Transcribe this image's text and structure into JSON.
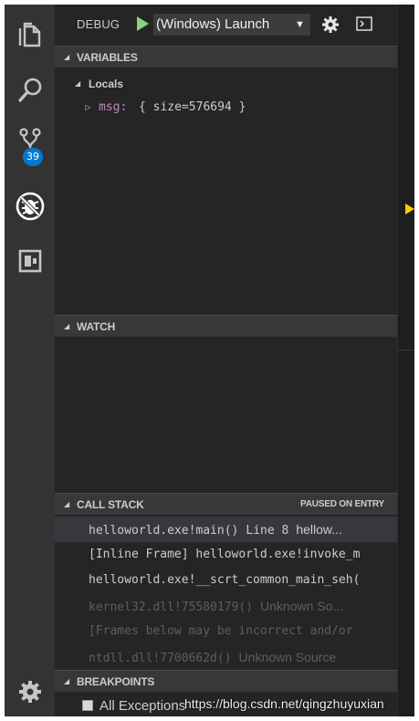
{
  "activity_bar": {
    "scm_badge": "39",
    "icons": [
      "files-icon",
      "search-icon",
      "source-control-icon",
      "debug-icon",
      "extensions-icon",
      "settings-gear-icon"
    ]
  },
  "toolbar": {
    "debug_label": "DEBUG",
    "launch_config": "(Windows) Launch",
    "dropdown_arrow": "▼"
  },
  "variables": {
    "header": "VARIABLES",
    "locals_label": "Locals",
    "items": [
      {
        "name": "msg:",
        "value": "{ size=576694 }"
      }
    ]
  },
  "watch": {
    "header": "WATCH"
  },
  "call_stack": {
    "header": "CALL STACK",
    "status": "PAUSED ON ENTRY",
    "frames": [
      {
        "name": "helloworld.exe!main()",
        "line": "Line 8",
        "source": "hellow..."
      },
      {
        "name": "[Inline Frame] helloworld.exe!invoke_m",
        "line": "",
        "source": ""
      },
      {
        "name": "helloworld.exe!__scrt_common_main_seh(",
        "line": "",
        "source": ""
      },
      {
        "name": "kernel32.dll!75580179()",
        "line": "",
        "source": "Unknown So..."
      },
      {
        "name": "[Frames below may be incorrect and/or",
        "line": "",
        "source": ""
      },
      {
        "name": "ntdll.dll!7700662d()",
        "line": "",
        "source": "Unknown Source"
      }
    ]
  },
  "breakpoints": {
    "header": "BREAKPOINTS",
    "items": [
      {
        "label": "All Exceptions",
        "checked": false
      }
    ]
  },
  "watermark": "https://blog.csdn.net/qingzhuyuxian",
  "colors": {
    "accent": "#007acc",
    "play": "#89d185",
    "variable_name": "#c586c0",
    "breakpoint_indicator": "#ffcc00"
  }
}
